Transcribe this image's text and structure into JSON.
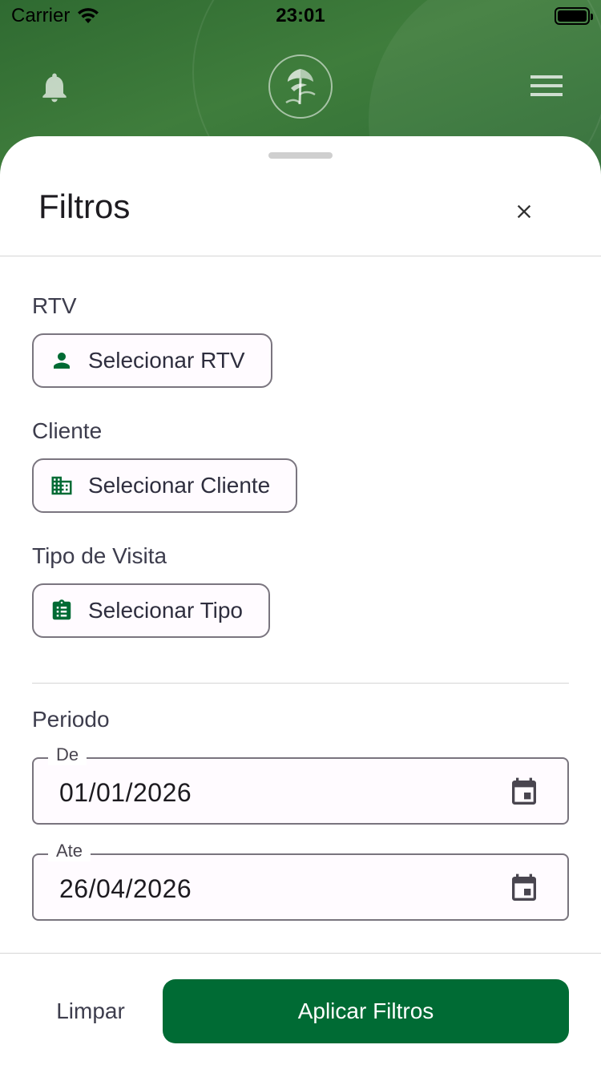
{
  "status_bar": {
    "carrier": "Carrier",
    "time": "23:01"
  },
  "header": {
    "icons": [
      "bell-icon",
      "brand-logo",
      "menu-icon"
    ]
  },
  "sheet": {
    "title": "Filtros",
    "sections": {
      "rtv": {
        "label": "RTV",
        "button": "Selecionar RTV",
        "icon": "person-icon"
      },
      "cliente": {
        "label": "Cliente",
        "button": "Selecionar Cliente",
        "icon": "building-icon"
      },
      "tipo": {
        "label": "Tipo de Visita",
        "button": "Selecionar Tipo",
        "icon": "clipboard-list-icon"
      }
    },
    "periodo": {
      "label": "Periodo",
      "from": {
        "label": "De",
        "value": "01/01/2026"
      },
      "to": {
        "label": "Ate",
        "value": "26/04/2026"
      }
    },
    "actions": {
      "clear": "Limpar",
      "apply": "Aplicar Filtros"
    }
  },
  "colors": {
    "primary": "#006b34",
    "header_green": "#3f7d3c",
    "outline": "#79747e"
  }
}
